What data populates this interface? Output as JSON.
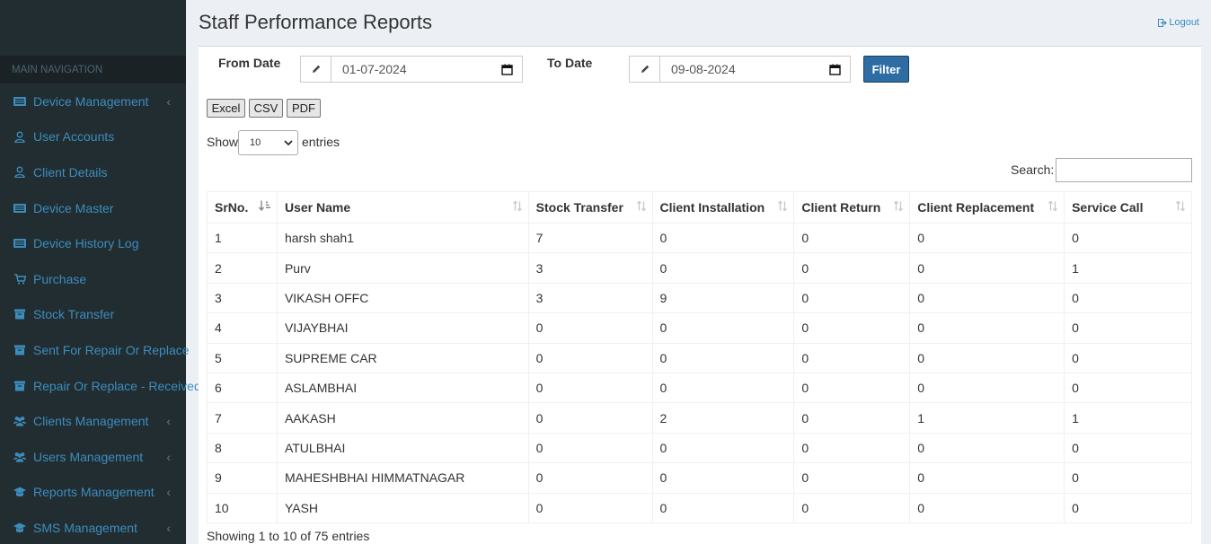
{
  "sidebar": {
    "nav_header": "MAIN NAVIGATION",
    "items": [
      {
        "label": "Device Management",
        "icon": "list-icon",
        "chevron": true
      },
      {
        "label": "User Accounts",
        "icon": "user-icon",
        "chevron": false
      },
      {
        "label": "Client Details",
        "icon": "user-icon",
        "chevron": false
      },
      {
        "label": "Device Master",
        "icon": "list-icon",
        "chevron": false
      },
      {
        "label": "Device History Log",
        "icon": "list-icon",
        "chevron": false
      },
      {
        "label": "Purchase",
        "icon": "cart-icon",
        "chevron": false
      },
      {
        "label": "Stock Transfer",
        "icon": "archive-icon",
        "chevron": false
      },
      {
        "label": "Sent For Repair Or Replace",
        "icon": "archive-icon",
        "chevron": false
      },
      {
        "label": "Repair Or Replace - Received",
        "icon": "archive-icon",
        "chevron": false
      },
      {
        "label": "Clients Management",
        "icon": "users-icon",
        "chevron": true
      },
      {
        "label": "Users Management",
        "icon": "users-icon",
        "chevron": true
      },
      {
        "label": "Reports Management",
        "icon": "graduation-icon",
        "chevron": true
      },
      {
        "label": "SMS Management",
        "icon": "graduation-icon",
        "chevron": true
      }
    ],
    "chevron_glyph": "‹"
  },
  "header": {
    "title": "Staff Performance Reports",
    "logout_label": "Logout"
  },
  "filters": {
    "from_label": "From Date",
    "from_value": "01-07-2024",
    "to_label": "To Date",
    "to_value": "09-08-2024",
    "filter_label": "Filter"
  },
  "export": {
    "excel": "Excel",
    "csv": "CSV",
    "pdf": "PDF"
  },
  "length": {
    "show": "Show",
    "value": "10",
    "entries": "entries"
  },
  "search": {
    "label": "Search:",
    "value": ""
  },
  "table": {
    "columns": [
      "SrNo.",
      "User Name",
      "Stock Transfer",
      "Client Installation",
      "Client Return",
      "Client Replacement",
      "Service Call"
    ],
    "rows": [
      [
        "1",
        "harsh shah1",
        "7",
        "0",
        "0",
        "0",
        "0"
      ],
      [
        "2",
        "Purv",
        "3",
        "0",
        "0",
        "0",
        "1"
      ],
      [
        "3",
        "VIKASH OFFC",
        "3",
        "9",
        "0",
        "0",
        "0"
      ],
      [
        "4",
        "VIJAYBHAI",
        "0",
        "0",
        "0",
        "0",
        "0"
      ],
      [
        "5",
        "SUPREME CAR",
        "0",
        "0",
        "0",
        "0",
        "0"
      ],
      [
        "6",
        "ASLAMBHAI",
        "0",
        "0",
        "0",
        "0",
        "0"
      ],
      [
        "7",
        "AAKASH",
        "0",
        "2",
        "0",
        "1",
        "1"
      ],
      [
        "8",
        "ATULBHAI",
        "0",
        "0",
        "0",
        "0",
        "0"
      ],
      [
        "9",
        "MAHESHBHAI HIMMATNAGAR",
        "0",
        "0",
        "0",
        "0",
        "0"
      ],
      [
        "10",
        "YASH",
        "0",
        "0",
        "0",
        "0",
        "0"
      ]
    ],
    "info": "Showing 1 to 10 of 75 entries"
  },
  "colors": {
    "sidebar_bg": "#222d32",
    "accent": "#3c8dbc",
    "filter_btn": "#2e6da4"
  }
}
